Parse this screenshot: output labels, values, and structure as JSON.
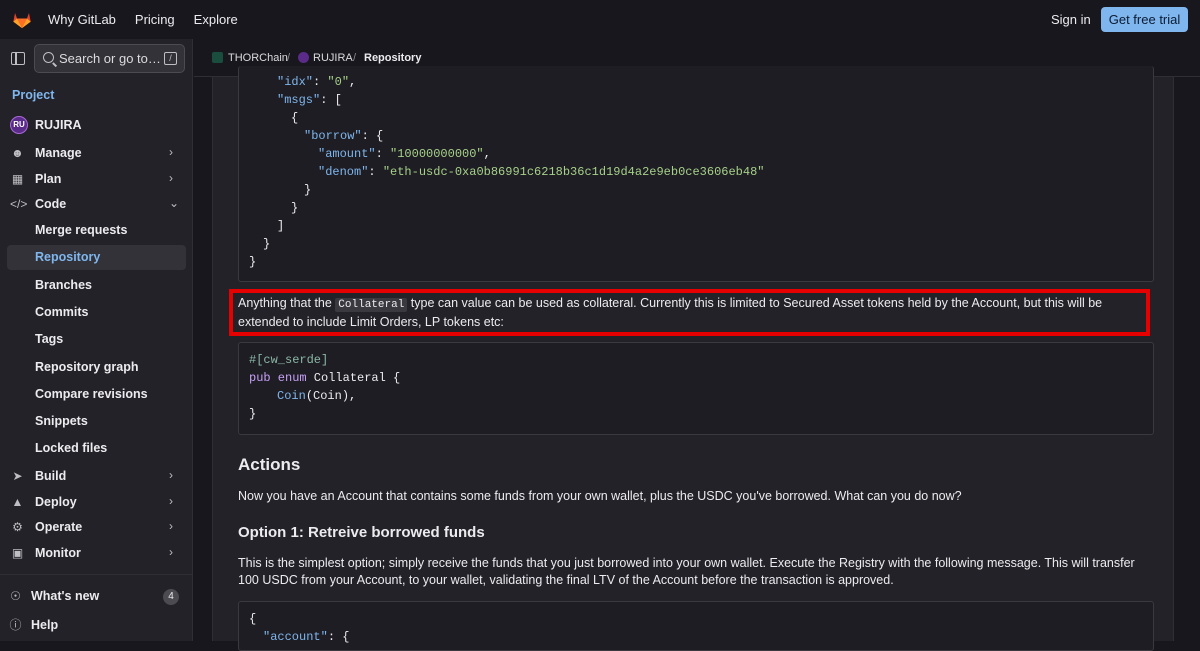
{
  "topbar": {
    "nav": [
      "Why GitLab",
      "Pricing",
      "Explore"
    ],
    "sign_in": "Sign in",
    "trial": "Get free trial"
  },
  "sidebar": {
    "search_placeholder": "Search or go to…",
    "search_shortcut": "/",
    "project_label": "Project",
    "project_name": "RUJIRA",
    "project_avatar": "RU",
    "items": [
      {
        "label": "Manage",
        "icon": "users-icon"
      },
      {
        "label": "Plan",
        "icon": "calendar-icon"
      },
      {
        "label": "Code",
        "icon": "code-icon"
      },
      {
        "label": "Build",
        "icon": "rocket-icon"
      },
      {
        "label": "Deploy",
        "icon": "deploy-icon"
      },
      {
        "label": "Operate",
        "icon": "operate-icon"
      },
      {
        "label": "Monitor",
        "icon": "monitor-icon"
      }
    ],
    "code_sub": [
      "Merge requests",
      "Repository",
      "Branches",
      "Commits",
      "Tags",
      "Repository graph",
      "Compare revisions",
      "Snippets",
      "Locked files"
    ],
    "whats_new": "What's new",
    "whats_new_count": "4",
    "help": "Help"
  },
  "breadcrumb": {
    "group": "THORChain",
    "project": "RUJIRA",
    "current": "Repository"
  },
  "content": {
    "code1": [
      "\"idx\": \"0\",",
      "\"msgs\": [",
      "{",
      "\"borrow\": {",
      "\"amount\": \"10000000000\",",
      "\"denom\": \"eth-usdc-0xa0b86991c6218b36c1d19d4a2e9eb0ce3606eb48\"",
      "}",
      "}",
      "]",
      "}",
      "}"
    ],
    "para1_before": "Anything that the ",
    "para1_code": "Collateral",
    "para1_after": " type can value can be used as collateral. Currently this is limited to Secured Asset tokens held by the Account, but this will be extended to include Limit Orders, LP tokens etc:",
    "code2": [
      "#[cw_serde]",
      "pub enum Collateral {",
      "Coin(Coin),",
      "}"
    ],
    "actions_heading": "Actions",
    "actions_text": "Now you have an Account that contains some funds from your own wallet, plus the USDC you've borrowed. What can you do now?",
    "option1_heading": "Option 1: Retreive borrowed funds",
    "option1_text": "This is the simplest option; simply receive the funds that you just borrowed into your own wallet. Execute the Registry with the following message. This will transfer 100 USDC from your Account, to your wallet, validating the final LTV of the Account before the transaction is approved.",
    "code3": [
      "{",
      "\"account\": {"
    ]
  },
  "colors": {
    "accent": "#7fb6ed",
    "highlight_border": "#e60000"
  }
}
